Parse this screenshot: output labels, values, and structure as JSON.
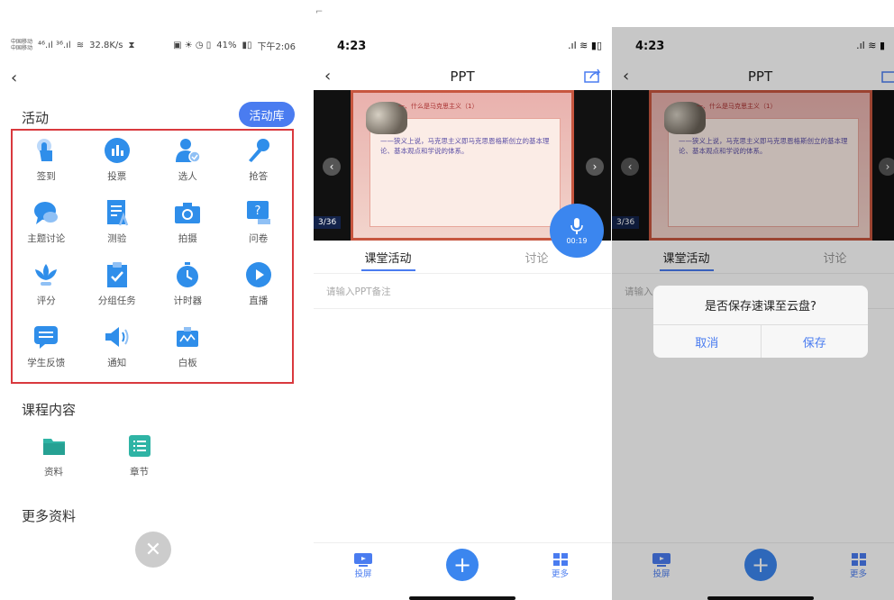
{
  "left_phone": {
    "status": {
      "carrier1": "中国移动",
      "carrier2": "中国移动",
      "signal": "⁴⁶.ıl ³⁶.ıl",
      "speed": "32.8K/s",
      "right": "41%",
      "time": "下午2:06"
    },
    "activity_title": "活动",
    "activity_library": "活动库",
    "activities": [
      {
        "label": "签到",
        "icon": "tap-icon"
      },
      {
        "label": "投票",
        "icon": "bar-chart-icon"
      },
      {
        "label": "选人",
        "icon": "user-check-icon"
      },
      {
        "label": "抢答",
        "icon": "microphone-icon"
      },
      {
        "label": "主题讨论",
        "icon": "chat-bubble-icon"
      },
      {
        "label": "测验",
        "icon": "quiz-icon"
      },
      {
        "label": "拍摄",
        "icon": "camera-icon"
      },
      {
        "label": "问卷",
        "icon": "question-icon"
      },
      {
        "label": "评分",
        "icon": "lotus-icon"
      },
      {
        "label": "分组任务",
        "icon": "clipboard-check-icon"
      },
      {
        "label": "计时器",
        "icon": "timer-icon"
      },
      {
        "label": "直播",
        "icon": "play-icon"
      },
      {
        "label": "学生反馈",
        "icon": "feedback-icon"
      },
      {
        "label": "通知",
        "icon": "speaker-icon"
      },
      {
        "label": "白板",
        "icon": "whiteboard-icon"
      }
    ],
    "course_title": "课程内容",
    "course_items": [
      {
        "label": "资料",
        "icon": "folder-icon"
      },
      {
        "label": "章节",
        "icon": "list-icon"
      }
    ],
    "more_title": "更多资料"
  },
  "ppt_screen": {
    "time": "4:23",
    "title": "PPT",
    "slide_heading": "一、什么是马克思主义（1）",
    "slide_text": "——狭义上说，马克思主义即马克思恩格斯创立的基本理论、基本观点和学说的体系。",
    "page": "3/36",
    "tab_activity": "课堂活动",
    "tab_discuss": "讨论",
    "note_placeholder": "请输入PPT备注",
    "mic_time": "00:19",
    "cast": "投屏",
    "more": "更多"
  },
  "dialog_screen": {
    "time": "4:23",
    "title": "PPT",
    "page": "3/36",
    "tab_activity": "课堂活动",
    "tab_discuss": "讨论",
    "note_placeholder": "请输入",
    "question": "是否保存速课至云盘?",
    "cancel": "取消",
    "save": "保存",
    "cast": "投屏",
    "more": "更多"
  },
  "colors": {
    "accent": "#4a7cf0",
    "highlight_box": "#d9393e",
    "icon_blue": "#2f8eea"
  }
}
